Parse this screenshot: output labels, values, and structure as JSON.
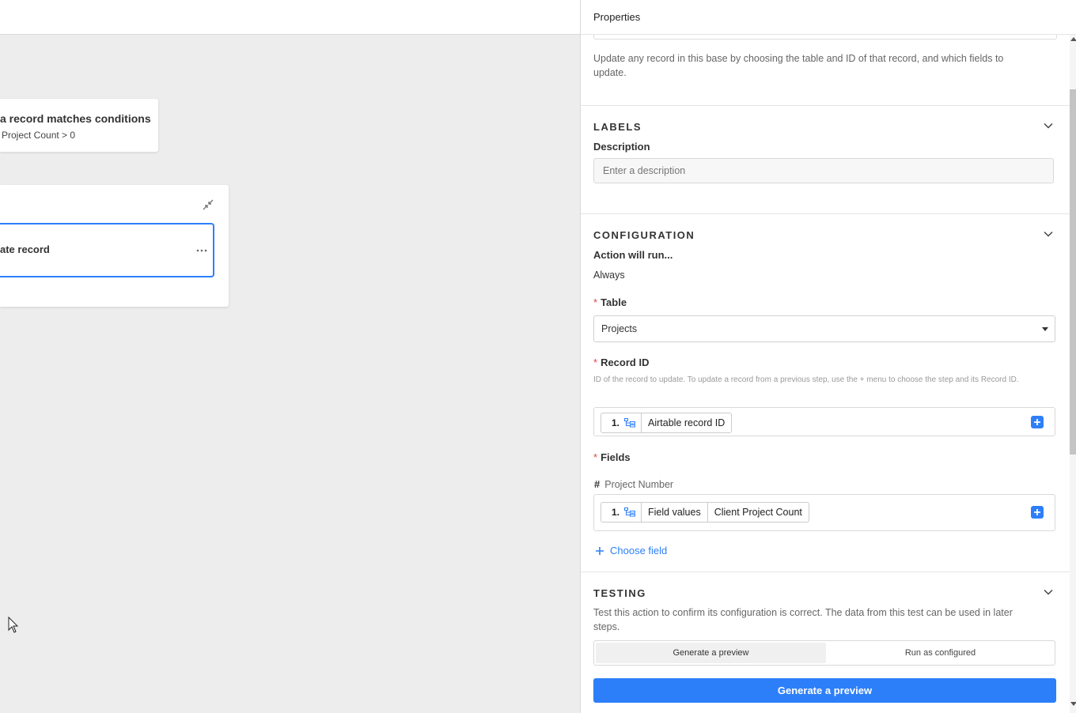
{
  "canvas": {
    "trigger": {
      "title": "a record matches conditions",
      "condition": "Project Count > 0"
    },
    "action": {
      "label": "ate record"
    }
  },
  "panel": {
    "title": "Properties",
    "description": "Update any record in this base by choosing the table and ID of that record, and which fields to update.",
    "labels": {
      "heading": "LABELS",
      "description_label": "Description",
      "description_placeholder": "Enter a description"
    },
    "configuration": {
      "heading": "CONFIGURATION",
      "run_label": "Action will run...",
      "run_value": "Always",
      "table_label": "Table",
      "table_value": "Projects",
      "record_id_label": "Record ID",
      "record_id_hint": "ID of the record to update. To update a record from a previous step, use the + menu to choose the step and its Record ID.",
      "record_token": {
        "step": "1.",
        "value": "Airtable record ID"
      },
      "fields_label": "Fields",
      "field_name": "Project Number",
      "field_token": {
        "step": "1.",
        "part1": "Field values",
        "part2": "Client Project Count"
      },
      "choose_field": "Choose field"
    },
    "testing": {
      "heading": "TESTING",
      "description": "Test this action to confirm its configuration is correct. The data from this test can be used in later steps.",
      "tab_preview": "Generate a preview",
      "tab_run": "Run as configured",
      "button": "Generate a preview"
    },
    "colors": {
      "accent": "#2d7ff9",
      "required": "#e04444"
    }
  }
}
